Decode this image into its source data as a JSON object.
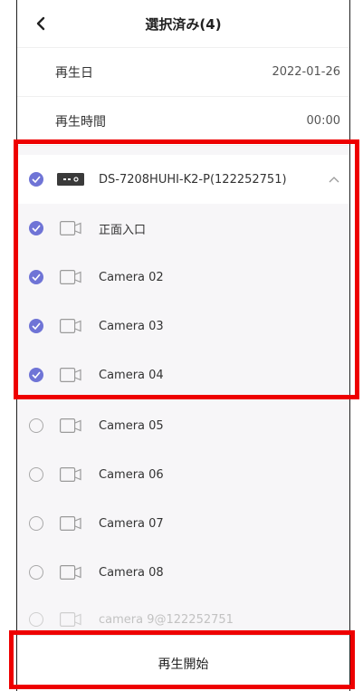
{
  "header": {
    "title": "選択済み(4)"
  },
  "info": [
    {
      "label": "再生日",
      "value": "2022-01-26"
    },
    {
      "label": "再生時間",
      "value": "00:00"
    }
  ],
  "device": {
    "name": "DS-7208HUHI-K2-P(122252751)",
    "checked": true,
    "expanded": true
  },
  "cameras": [
    {
      "name": "正面入口",
      "checked": true
    },
    {
      "name": "Camera 02",
      "checked": true
    },
    {
      "name": "Camera 03",
      "checked": true
    },
    {
      "name": "Camera 04",
      "checked": true
    },
    {
      "name": "Camera 05",
      "checked": false
    },
    {
      "name": "Camera 06",
      "checked": false
    },
    {
      "name": "Camera 07",
      "checked": false
    },
    {
      "name": "Camera 08",
      "checked": false
    },
    {
      "name": "camera 9@122252751",
      "checked": false
    }
  ],
  "footer": {
    "start_label": "再生開始"
  },
  "colors": {
    "accent": "#6f74d6",
    "highlight": "#ee0000"
  }
}
